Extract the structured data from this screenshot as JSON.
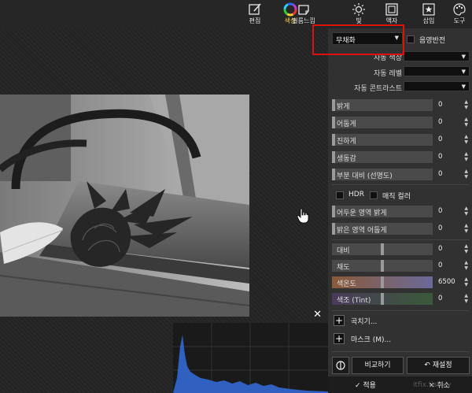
{
  "toolbar": {
    "items": [
      {
        "label": "편집",
        "icon": "edit-icon"
      },
      {
        "label": "색상",
        "icon": "color-wheel-icon"
      },
      {
        "label": "필름느낌",
        "icon": "film-icon"
      },
      {
        "label": "빛",
        "icon": "sun-icon"
      },
      {
        "label": "액자",
        "icon": "frame-icon"
      },
      {
        "label": "삽입",
        "icon": "star-insert-icon"
      },
      {
        "label": "도구",
        "icon": "palette-icon"
      }
    ]
  },
  "panel": {
    "mode_select": "무채화",
    "invert_label": "음영반전",
    "auto_color_label": "자동 색상",
    "auto_level_label": "자동 레벨",
    "auto_contrast_label": "자동 콘트라스트",
    "sliders_a": [
      {
        "label": "밝게",
        "value": "0",
        "level": 0
      },
      {
        "label": "어둡게",
        "value": "0",
        "level": 0
      },
      {
        "label": "진하게",
        "value": "0",
        "level": 0
      },
      {
        "label": "생동감",
        "value": "0",
        "level": 0
      },
      {
        "label": "부분 대비 (선명도)",
        "value": "0",
        "level": 0
      }
    ],
    "hdr_label": "HDR",
    "magic_label": "매직 컬러",
    "sliders_b": [
      {
        "label": "어두운 영역 밝게",
        "value": "0",
        "level": 0
      },
      {
        "label": "밝은 영역 어둡게",
        "value": "0",
        "level": 0
      }
    ],
    "sliders_c": [
      {
        "label": "대비",
        "value": "0",
        "level": 0.5
      },
      {
        "label": "채도",
        "value": "0",
        "level": 0.5
      },
      {
        "label": "색온도",
        "value": "6500",
        "level": 0.5
      },
      {
        "label": "색조 (Tint)",
        "value": "0",
        "level": 0.5
      }
    ],
    "curves_label": "곡치기...",
    "mask_label": "마스크 (M)...",
    "compare_label": "비교하기",
    "reset_label": "재설정",
    "apply_label": "적용",
    "cancel_label": "취소",
    "watermark": "itfix.tistory"
  },
  "histogram": {
    "close": "✕"
  },
  "colors": {
    "accent_red": "#e01010",
    "temp_gradient": "#8a5a3a",
    "tint_gradient": "#4a3a5a"
  }
}
